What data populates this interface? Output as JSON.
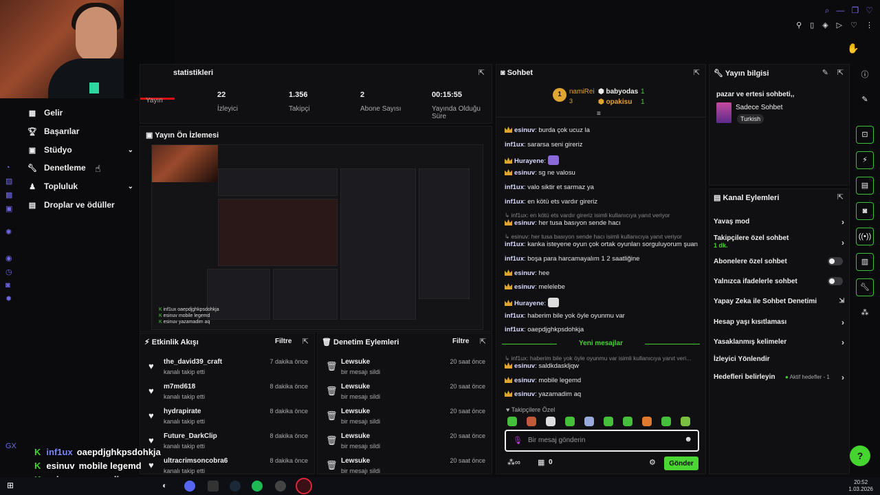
{
  "nav": {
    "items": [
      {
        "label": "Gelir",
        "icon": "chart-icon"
      },
      {
        "label": "Başarılar",
        "icon": "trophy-icon"
      },
      {
        "label": "Stüdyo",
        "icon": "studio-icon"
      },
      {
        "label": "Denetleme",
        "icon": "wrench-icon"
      },
      {
        "label": "Topluluk",
        "icon": "community-icon"
      },
      {
        "label": "Droplar ve ödüller",
        "icon": "drops-icon"
      }
    ]
  },
  "stats": {
    "title": "statistikleri",
    "items": [
      {
        "value": "",
        "label": "Yayın"
      },
      {
        "value": "22",
        "label": "İzleyici"
      },
      {
        "value": "1.356",
        "label": "Takipçi"
      },
      {
        "value": "2",
        "label": "Abone Sayısı"
      },
      {
        "value": "00:15:55",
        "label": "Yayında Olduğu Süre"
      }
    ]
  },
  "preview": {
    "title": "Yayın Ön İzlemesi"
  },
  "activity": {
    "title": "Etkinlik Akışı",
    "filter": "Filtre",
    "items": [
      {
        "name": "the_david39_craft",
        "sub": "kanalı takip etti",
        "time": "7 dakika önce"
      },
      {
        "name": "m7md618",
        "sub": "kanalı takip etti",
        "time": "8 dakika önce"
      },
      {
        "name": "hydrapirate",
        "sub": "kanalı takip etti",
        "time": "8 dakika önce"
      },
      {
        "name": "Future_DarkClip",
        "sub": "kanalı takip etti",
        "time": "8 dakika önce"
      },
      {
        "name": "ultracrimsoncobra6",
        "sub": "kanalı takip etti",
        "time": "8 dakika önce"
      }
    ]
  },
  "modlog": {
    "title": "Denetim Eylemleri",
    "filter": "Filtre",
    "items": [
      {
        "name": "Lewsuke",
        "sub": "bir mesajı sildi",
        "time": "20 saat önce"
      },
      {
        "name": "Lewsuke",
        "sub": "bir mesajı sildi",
        "time": "20 saat önce"
      },
      {
        "name": "Lewsuke",
        "sub": "bir mesajı sildi",
        "time": "20 saat önce"
      },
      {
        "name": "Lewsuke",
        "sub": "bir mesajı sildi",
        "time": "20 saat önce"
      },
      {
        "name": "Lewsuke",
        "sub": "bir mesajı sildi",
        "time": "20 saat önce"
      }
    ]
  },
  "chat": {
    "title": "Sohbet",
    "leaders": {
      "first": {
        "rank": "1",
        "name": "namiRei",
        "count": "3"
      },
      "second": {
        "name": "babyodas",
        "count": "1"
      },
      "third": {
        "name": "opakisu",
        "count": "1"
      }
    },
    "messages": [
      {
        "user": "esinuv",
        "text": "burda çok ucuz la"
      },
      {
        "user": "inf1ux",
        "text": "sararsa seni gireriz"
      },
      {
        "user": "Hurayene",
        "text": ""
      },
      {
        "user": "esinuv",
        "text": "sg ne valosu"
      },
      {
        "user": "inf1ux",
        "text": "valo siktir et sarmaz ya"
      },
      {
        "user": "inf1ux",
        "text": "en kötü ets vardır gireriz"
      },
      {
        "reply": "inf1ux: en kötü ets vardır gireriz isimli kullanıcıya yanıt veriyor",
        "user": "esinuv",
        "text": "her tusa basıyon sende hacı"
      },
      {
        "reply": "esinuv: her tusa basıyon sende hacı isimli kullanıcıya yanıt veriyor",
        "user": "inf1ux",
        "text": "kanka isteyene oyun çok ortak oyunları sorguluyorum şuan"
      },
      {
        "user": "inf1ux",
        "text": "boşa para harcamayalım 1 2 saatliğine"
      },
      {
        "user": "esinuv",
        "text": "hee"
      },
      {
        "user": "esinuv",
        "text": "melelebe"
      },
      {
        "user": "Hurayene",
        "text": ""
      },
      {
        "user": "inf1ux",
        "text": "haberim bile yok öyle oyunmu var"
      },
      {
        "user": "inf1ux",
        "text": "oaepdjghkpsdohkja"
      }
    ],
    "new_messages": "Yeni mesajlar",
    "after": [
      {
        "reply": "inf1ux: haberim bile yok öyle oyunmu var isimli kullanıcıya yanıt veri...",
        "user": "esinuv",
        "text": "saldkdaskljqw"
      },
      {
        "user": "esinuv",
        "text": "mobile legemd"
      },
      {
        "user": "esinuv",
        "text": "yazamadim aq"
      }
    ],
    "followers_only": "Takipçilere Özel",
    "input_placeholder": "Bir mesaj gönderin",
    "points": "0",
    "send": "Gönder"
  },
  "info": {
    "title": "Yayın bilgisi",
    "stream_title": "pazar ve ertesi sohbeti,,",
    "category": "Sadece Sohbet",
    "tag": "Turkish"
  },
  "actions": {
    "title": "Kanal Eylemleri",
    "items": [
      {
        "label": "Yavaş mod",
        "kind": "arrow"
      },
      {
        "label": "Takipçilere özel sohbet",
        "sub": "1 dk.",
        "kind": "arrow"
      },
      {
        "label": "Abonelere özel sohbet",
        "kind": "toggle"
      },
      {
        "label": "Yalnızca ifadelerle sohbet",
        "kind": "toggle"
      },
      {
        "label": "Yapay Zeka ile Sohbet Denetimi",
        "kind": "external"
      },
      {
        "label": "Hesap yaşı kısıtlaması",
        "kind": "arrow"
      },
      {
        "label": "Yasaklanmış kelimeler",
        "kind": "arrow"
      },
      {
        "label": "İzleyici Yönlendir",
        "kind": "none"
      },
      {
        "label": "Hedefleri belirleyin",
        "extra": "Aktif hedefler - 1",
        "kind": "arrow"
      }
    ]
  },
  "overlay_chat": [
    {
      "user": "inf1ux",
      "text": "oaepdjghkpsdohkja"
    },
    {
      "user": "esinuv",
      "text": "mobile legemd"
    },
    {
      "user": "esinuv",
      "text": "yazamadim aq"
    }
  ],
  "taskbar": {
    "time": "20:52",
    "date": "1.03.2026"
  },
  "colors": {
    "accent": "#45d430",
    "purple": "#7a6cf0",
    "panel": "#101012"
  }
}
